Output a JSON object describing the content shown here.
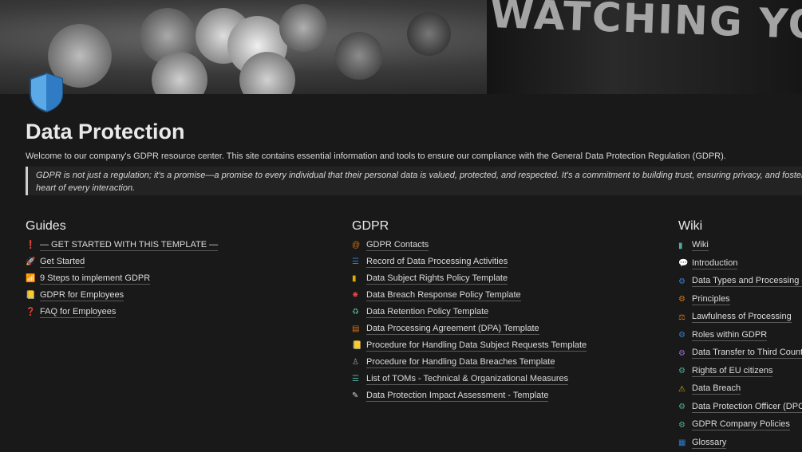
{
  "page": {
    "title": "Data Protection",
    "intro": "Welcome to our company's GDPR resource center. This site contains essential information and tools to ensure our compliance with the General Data Protection Regulation (GDPR).",
    "quote_line1": "GDPR is not just a regulation; it's a promise—a promise to every individual that their personal data is valued, protected, and respected. It's a commitment to building trust, ensuring privacy, and fostering a digital",
    "quote_line2": "heart of every interaction.",
    "cover_text": "WATCHING YOU"
  },
  "guides": {
    "heading": "Guides",
    "items": [
      {
        "icon": "exclamation-icon",
        "glyph": "❗",
        "color": "#e03e3e",
        "label": "— GET STARTED WITH THIS TEMPLATE —"
      },
      {
        "icon": "rocket-icon",
        "glyph": "🚀",
        "color": "#d9730d",
        "label": "Get Started"
      },
      {
        "icon": "chart-icon",
        "glyph": "📶",
        "color": "#2e7dd1",
        "label": "9 Steps to implement GDPR"
      },
      {
        "icon": "note-icon",
        "glyph": "📒",
        "color": "#dfab01",
        "label": "GDPR for Employees"
      },
      {
        "icon": "question-icon",
        "glyph": "❓",
        "color": "#e03e3e",
        "label": "FAQ for Employees"
      }
    ]
  },
  "gdpr": {
    "heading": "GDPR",
    "items": [
      {
        "icon": "at-icon",
        "glyph": "@",
        "color": "#d9730d",
        "label": "GDPR Contacts"
      },
      {
        "icon": "list-icon",
        "glyph": "☰",
        "color": "#2e7dd1",
        "label": "Record of Data Processing Activities"
      },
      {
        "icon": "bottle-icon",
        "glyph": "▮",
        "color": "#dfab01",
        "label": "Data Subject Rights Policy Template"
      },
      {
        "icon": "burst-icon",
        "glyph": "✸",
        "color": "#e03e3e",
        "label": "Data Breach Response Policy Template"
      },
      {
        "icon": "recycle-icon",
        "glyph": "♻",
        "color": "#4dab9a",
        "label": "Data Retention Policy Template"
      },
      {
        "icon": "document-icon",
        "glyph": "▤",
        "color": "#d9730d",
        "label": "Data Processing Agreement (DPA) Template"
      },
      {
        "icon": "memo-icon",
        "glyph": "📒",
        "color": "#dfab01",
        "label": "Procedure for Handling Data Subject Requests Template"
      },
      {
        "icon": "person-icon",
        "glyph": "♙",
        "color": "#9b9b9b",
        "label": "Procedure for Handling Data Breaches Template"
      },
      {
        "icon": "list-green-icon",
        "glyph": "☰",
        "color": "#4dab9a",
        "label": "List of TOMs - Technical & Organizational Measures"
      },
      {
        "icon": "pencil-icon",
        "glyph": "✎",
        "color": "#cfcfcf",
        "label": "Data Protection Impact Assessment - Template"
      }
    ]
  },
  "wiki": {
    "heading": "Wiki",
    "items": [
      {
        "icon": "book-icon",
        "glyph": "▮",
        "color": "#4dab9a",
        "label": "Wiki"
      },
      {
        "icon": "speech-icon",
        "glyph": "💬",
        "color": "#cfcfcf",
        "label": "Introduction"
      },
      {
        "icon": "gear-person-icon",
        "glyph": "⚙",
        "color": "#2e7dd1",
        "label": "Data Types and Processing of"
      },
      {
        "icon": "gear-person-icon",
        "glyph": "⚙",
        "color": "#d9730d",
        "label": "Principles"
      },
      {
        "icon": "scales-icon",
        "glyph": "⚖",
        "color": "#d9730d",
        "label": "Lawfulness of Processing"
      },
      {
        "icon": "gear-person-icon",
        "glyph": "⚙",
        "color": "#2e7dd1",
        "label": "Roles within GDPR"
      },
      {
        "icon": "gear-person-icon",
        "glyph": "⚙",
        "color": "#9b6bd1",
        "label": "Data Transfer to Third Countr"
      },
      {
        "icon": "gear-person-icon",
        "glyph": "⚙",
        "color": "#4dab9a",
        "label": "Rights of EU citizens"
      },
      {
        "icon": "warning-icon",
        "glyph": "⚠",
        "color": "#dfab01",
        "label": "Data Breach"
      },
      {
        "icon": "gear-person-icon",
        "glyph": "⚙",
        "color": "#4dab9a",
        "label": "Data Protection Officer (DPO"
      },
      {
        "icon": "gear-person-icon",
        "glyph": "⚙",
        "color": "#4dab9a",
        "label": "GDPR Company Policies"
      },
      {
        "icon": "glossary-icon",
        "glyph": "▦",
        "color": "#2e7dd1",
        "label": "Glossary"
      }
    ]
  }
}
